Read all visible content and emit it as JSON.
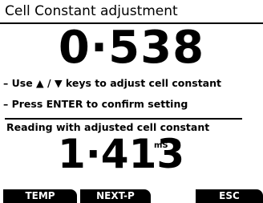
{
  "title": "Cell Constant adjustment",
  "cell_constant_value": "0·538",
  "instructions": {
    "line1_prefix": "– Use ",
    "line1_suffix": " keys to adjust cell constant",
    "line2": "– Press ENTER to confirm setting",
    "up_icon": "triangle-up",
    "down_icon": "triangle-down",
    "separator": " / "
  },
  "reading": {
    "label": "Reading with adjusted cell constant",
    "value": "1·413",
    "unit": "mS"
  },
  "softkeys": {
    "key1": "TEMP",
    "key2": "NEXT-P",
    "key4": "ESC"
  }
}
